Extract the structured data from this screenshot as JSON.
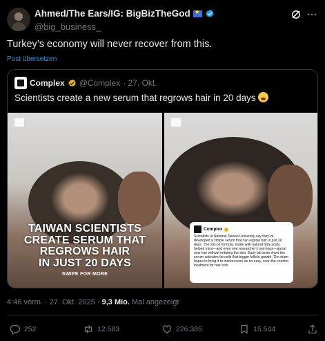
{
  "post": {
    "display_name": "Ahmed/The Ears/IG: BigBizTheGod",
    "handle": "@big_business_",
    "text": "Turkey’s economy will never recover from this.",
    "translate_label": "Post übersetzen",
    "icons": [
      "flag-icon",
      "verified-icon",
      "grok-icon",
      "more-icon"
    ]
  },
  "quote": {
    "name": "Complex",
    "handle": "@Complex",
    "date": "· 27. Okt.",
    "text": "Scientists create a new serum that regrows hair in 20 days",
    "emoji": "mind-blown-emoji",
    "image_left": {
      "headline": "TAIWAN SCIENTISTS\nCREATE SERUM THAT\nREGROWS HAIR\nIN JUST 20 DAYS",
      "cta": "SWIPE FOR MORE"
    },
    "image_right": {
      "card_name": "Complex",
      "card_body": "Scientists at National Taiwan University say they’ve developed a simple serum that can regrow hair in just 20 days. The rub-on formula, made with natural fatty acids, helped mice—and even one researcher’s own legs—sprout new hair without irritating the skin. Early lab tests show the serum activates fat cells that trigger follicle growth. The team hopes to bring it to market soon as an easy, over-the-counter treatment for hair loss."
    }
  },
  "meta": {
    "time": "4:46 vorm.",
    "date": "27. Okt. 2025",
    "views": "9,3 Mio.",
    "views_label": "Mal angezeigt"
  },
  "actions": {
    "replies": "252",
    "reposts": "12.583",
    "likes": "226.385",
    "bookmarks": "15.544"
  },
  "colors": {
    "background": "#000000",
    "text": "#e7e9ea",
    "secondary": "#71767b",
    "link": "#1d9bf0",
    "border": "#2f3336"
  }
}
